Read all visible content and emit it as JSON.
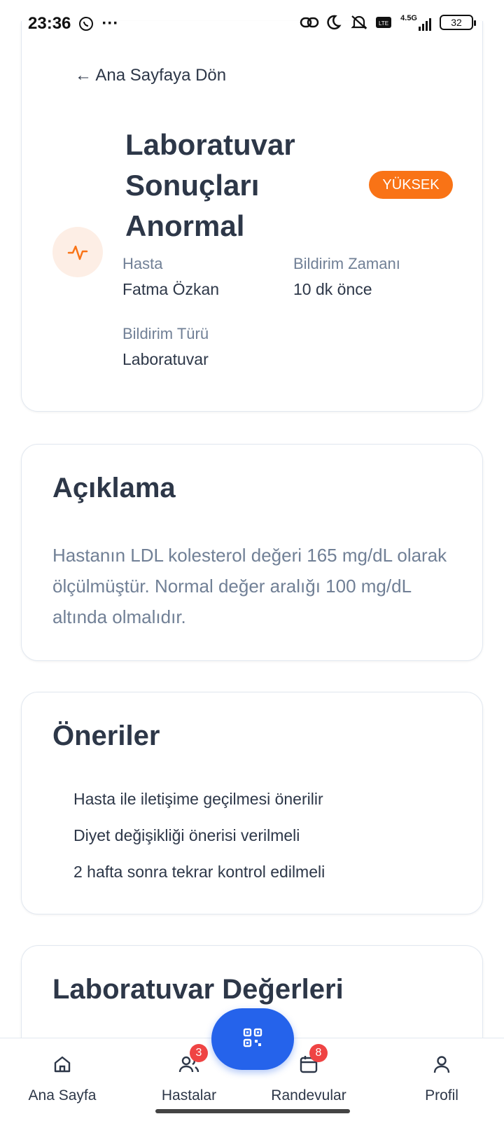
{
  "status_bar": {
    "time": "23:36",
    "dots": "···",
    "network": "4.5G",
    "battery": "32"
  },
  "header_card": {
    "back_label": "← Ana Sayfaya Dön",
    "title": "Laboratuvar Sonuçları Anormal",
    "priority_badge": "YÜKSEK",
    "patient_label": "Hasta",
    "patient_value": "Fatma Özkan",
    "time_label": "Bildirim Zamanı",
    "time_value": "10 dk önce",
    "type_label": "Bildirim Türü",
    "type_value": "Laboratuvar",
    "icon": "pulse-icon",
    "accent_color": "#f97316"
  },
  "description_card": {
    "heading": "Açıklama",
    "text": "Hastanın LDL kolesterol değeri 165 mg/dL olarak ölçülmüştür. Normal değer aralığı 100 mg/dL altında olmalıdır."
  },
  "suggestions_card": {
    "heading": "Öneriler",
    "items": [
      "Hasta ile iletişime geçilmesi önerilir",
      "Diyet değişikliği önerisi verilmeli",
      "2 hafta sonra tekrar kontrol edilmeli"
    ]
  },
  "lab_card": {
    "heading": "Laboratuvar Değerleri"
  },
  "bottom_nav": {
    "items": [
      {
        "label": "Ana Sayfa",
        "icon": "home-icon"
      },
      {
        "label": "Hastalar",
        "icon": "users-icon",
        "badge": "3"
      },
      {
        "label": "Randevular",
        "icon": "calendar-icon",
        "badge": "8"
      },
      {
        "label": "Profil",
        "icon": "user-icon"
      }
    ],
    "fab_icon": "qr-code-icon",
    "fab_color": "#2563eb"
  }
}
